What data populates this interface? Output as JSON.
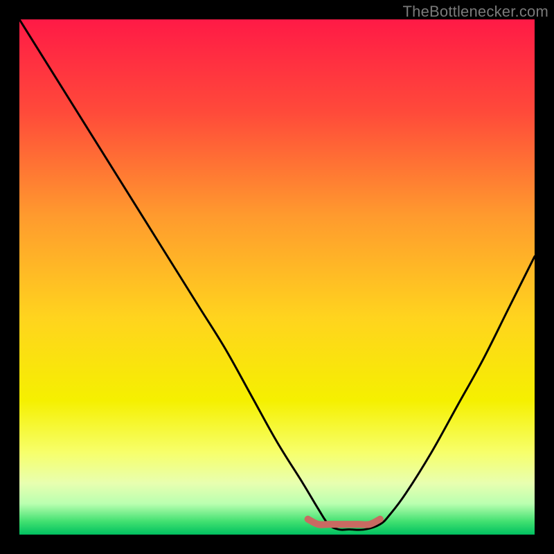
{
  "watermark": "TheBottlenecker.com",
  "chart_data": {
    "type": "line",
    "title": "",
    "xlabel": "",
    "ylabel": "",
    "xlim": [
      0,
      100
    ],
    "ylim": [
      0,
      100
    ],
    "gradient_stops": [
      {
        "offset": 0.0,
        "color": "#ff1a46"
      },
      {
        "offset": 0.18,
        "color": "#ff4a3a"
      },
      {
        "offset": 0.38,
        "color": "#ff9a2e"
      },
      {
        "offset": 0.58,
        "color": "#ffd41e"
      },
      {
        "offset": 0.74,
        "color": "#f5f000"
      },
      {
        "offset": 0.84,
        "color": "#f7ff6a"
      },
      {
        "offset": 0.9,
        "color": "#e8ffb0"
      },
      {
        "offset": 0.94,
        "color": "#baffb0"
      },
      {
        "offset": 0.975,
        "color": "#40e070"
      },
      {
        "offset": 1.0,
        "color": "#00c060"
      }
    ],
    "series": [
      {
        "name": "bottleneck-curve",
        "x": [
          0,
          5,
          10,
          15,
          20,
          25,
          30,
          35,
          40,
          45,
          50,
          55,
          58,
          60,
          62,
          64,
          67,
          70,
          72,
          75,
          80,
          85,
          90,
          95,
          100
        ],
        "y": [
          100,
          92,
          84,
          76,
          68,
          60,
          52,
          44,
          36,
          27,
          18,
          10,
          5,
          2,
          1,
          1,
          1,
          2,
          4,
          8,
          16,
          25,
          34,
          44,
          54
        ]
      },
      {
        "name": "optimal-band",
        "x": [
          56,
          58,
          60,
          62,
          64,
          66,
          68,
          70
        ],
        "y": [
          3,
          2,
          2,
          2,
          2,
          2,
          2,
          3
        ]
      }
    ]
  }
}
